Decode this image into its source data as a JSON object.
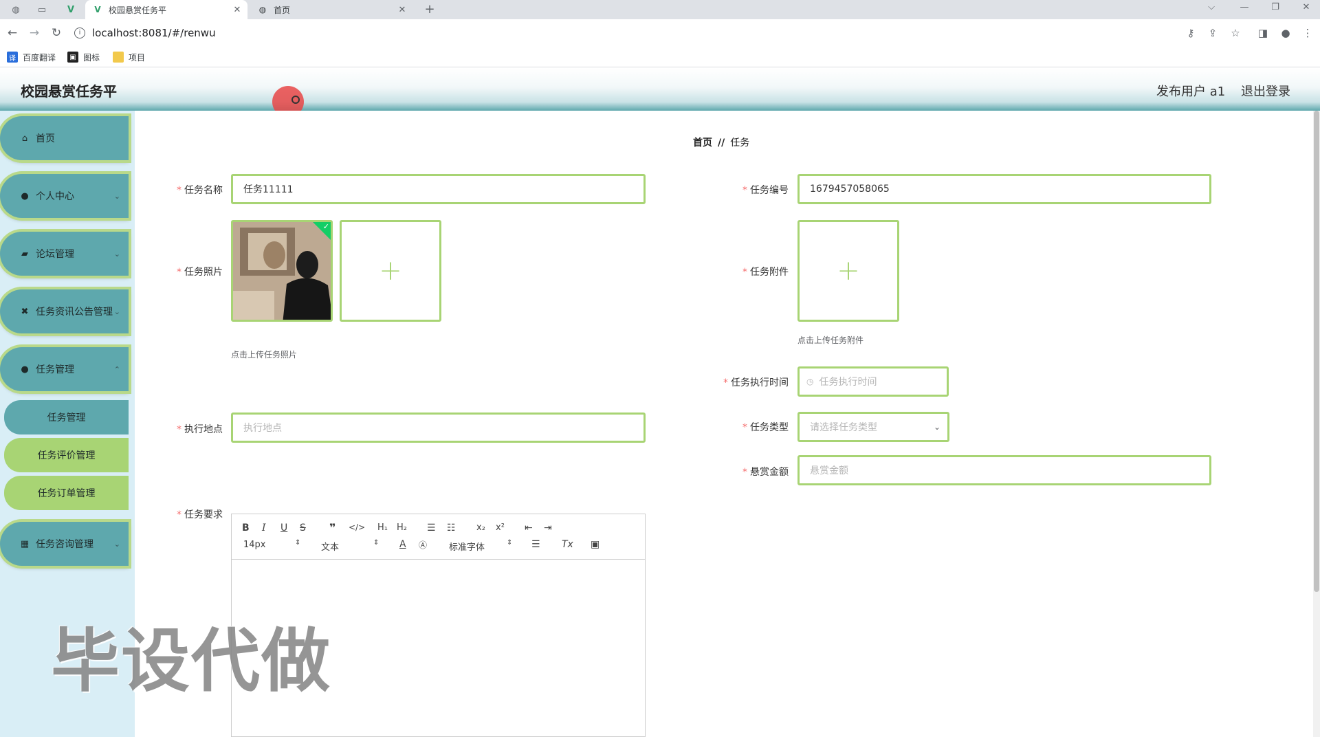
{
  "browser": {
    "tabs": [
      {
        "title": "校园悬赏任务平",
        "active": true
      },
      {
        "title": "首页",
        "active": false
      }
    ],
    "url": "localhost:8081/#/renwu",
    "bookmarks": [
      "百度翻译",
      "图标",
      "项目"
    ]
  },
  "header": {
    "title": "校园悬赏任务平",
    "user": "发布用户 a1",
    "logout": "退出登录"
  },
  "sidebar": {
    "items": [
      {
        "label": "首页",
        "icon": "home-icon"
      },
      {
        "label": "个人中心",
        "icon": "user-icon"
      },
      {
        "label": "论坛管理",
        "icon": "forum-icon"
      },
      {
        "label": "任务资讯公告管理",
        "icon": "news-icon"
      },
      {
        "label": "任务管理",
        "icon": "user-icon"
      }
    ],
    "subitems": [
      "任务管理",
      "任务评价管理",
      "任务订单管理"
    ],
    "last_item": {
      "label": "任务咨询管理",
      "icon": "grid-icon"
    }
  },
  "watermark": "毕设代做",
  "breadcrumb": {
    "home": "首页",
    "sep": "//",
    "current": "任务"
  },
  "form": {
    "name_label": "任务名称",
    "name_value": "任务11111",
    "code_label": "任务编号",
    "code_value": "1679457058065",
    "photo_label": "任务照片",
    "photo_hint": "点击上传任务照片",
    "attach_label": "任务附件",
    "attach_hint": "点击上传任务附件",
    "time_label": "任务执行时间",
    "time_placeholder": "任务执行时间",
    "place_label": "执行地点",
    "place_placeholder": "执行地点",
    "type_label": "任务类型",
    "type_placeholder": "请选择任务类型",
    "amount_label": "悬赏金额",
    "amount_placeholder": "悬赏金额",
    "req_label": "任务要求",
    "plus": "+"
  },
  "editor": {
    "font_size": "14px",
    "block": "文本",
    "font": "标准字体"
  }
}
